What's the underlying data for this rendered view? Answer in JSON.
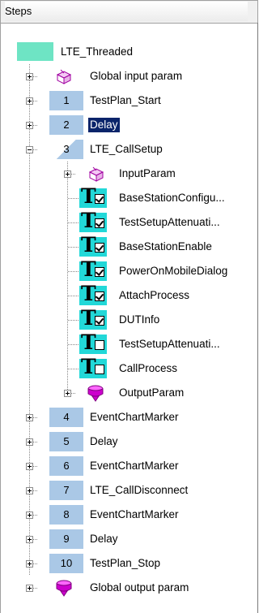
{
  "panel": {
    "title": "Steps"
  },
  "tree": {
    "root": {
      "label": "LTE_Threaded"
    },
    "rows": [
      {
        "label": "Global input param"
      },
      {
        "number": "1",
        "label": "TestPlan_Start"
      },
      {
        "number": "2",
        "label": "Delay",
        "selected": true
      },
      {
        "number": "3",
        "label": "LTE_CallSetup"
      },
      {
        "label": "InputParam"
      },
      {
        "label": "BaseStationConfigu...",
        "checked": true
      },
      {
        "label": "TestSetupAttenuati...",
        "checked": true
      },
      {
        "label": "BaseStationEnable",
        "checked": true
      },
      {
        "label": "PowerOnMobileDialog",
        "checked": true
      },
      {
        "label": "AttachProcess",
        "checked": true
      },
      {
        "label": "DUTInfo",
        "checked": true
      },
      {
        "label": "TestSetupAttenuati...",
        "checked": false
      },
      {
        "label": "CallProcess",
        "checked": false
      },
      {
        "label": "OutputParam"
      },
      {
        "number": "4",
        "label": "EventChartMarker"
      },
      {
        "number": "5",
        "label": "Delay"
      },
      {
        "number": "6",
        "label": "EventChartMarker"
      },
      {
        "number": "7",
        "label": "LTE_CallDisconnect"
      },
      {
        "number": "8",
        "label": "EventChartMarker"
      },
      {
        "number": "9",
        "label": "Delay"
      },
      {
        "number": "10",
        "label": "TestPlan_Stop"
      },
      {
        "label": "Global output param"
      }
    ]
  },
  "colors": {
    "step_number_bg": "#aac8e6",
    "root_icon": "#6ee4c4",
    "task_icon": "#22d8d8",
    "param_icon": "#cc00cc",
    "selection": "#0a246a"
  },
  "icons": {
    "input_param": "3d-box-icon",
    "output_param": "magenta-gem-icon",
    "task": "task-checkbox-icon"
  }
}
